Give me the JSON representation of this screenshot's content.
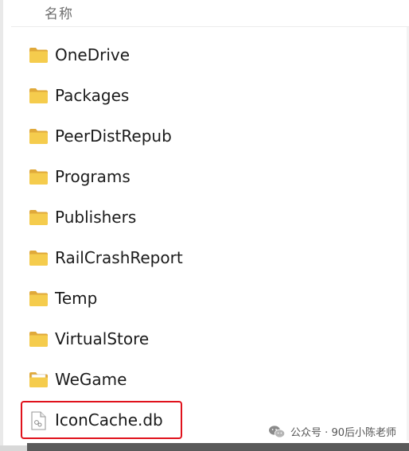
{
  "header": {
    "name_column_label": "名称"
  },
  "items": [
    {
      "label": "OneDrive",
      "type": "folder",
      "icon": "folder-icon"
    },
    {
      "label": "Packages",
      "type": "folder",
      "icon": "folder-icon"
    },
    {
      "label": "PeerDistRepub",
      "type": "folder",
      "icon": "folder-icon"
    },
    {
      "label": "Programs",
      "type": "folder",
      "icon": "folder-icon"
    },
    {
      "label": "Publishers",
      "type": "folder",
      "icon": "folder-icon"
    },
    {
      "label": "RailCrashReport",
      "type": "folder",
      "icon": "folder-icon"
    },
    {
      "label": "Temp",
      "type": "folder",
      "icon": "folder-icon"
    },
    {
      "label": "VirtualStore",
      "type": "folder",
      "icon": "folder-icon"
    },
    {
      "label": "WeGame",
      "type": "folder",
      "icon": "folder-open-icon"
    },
    {
      "label": "IconCache.db",
      "type": "file",
      "icon": "file-icon"
    }
  ],
  "highlight": {
    "color": "#e0121c",
    "target": "IconCache.db"
  },
  "watermark": {
    "text": "公众号 · 90后小陈老师",
    "icon": "wechat-icon"
  },
  "colors": {
    "folder": "#f2c744",
    "folder_back": "#e0a93a"
  }
}
